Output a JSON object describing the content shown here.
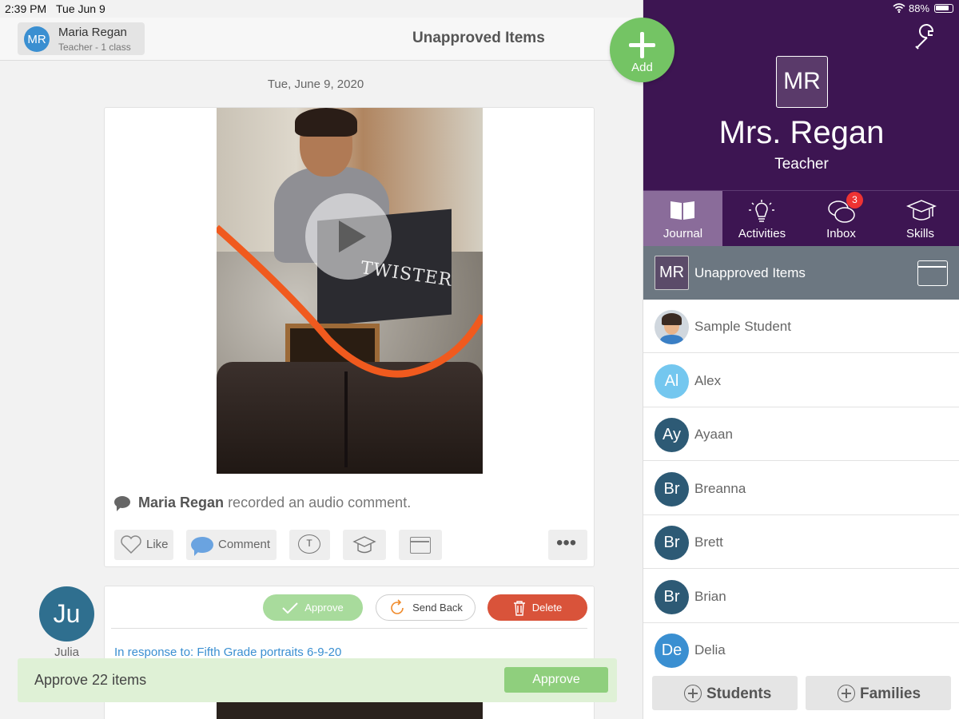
{
  "status_bar": {
    "time": "2:39 PM",
    "date": "Tue Jun 9",
    "battery": "88%"
  },
  "header": {
    "user_name": "Maria Regan",
    "user_role": "Teacher - 1 class",
    "user_initials": "MR",
    "title": "Unapproved Items"
  },
  "add_button": {
    "label": "Add"
  },
  "feed": {
    "date": "Tue, June 9, 2020",
    "post1": {
      "video_label": "TWISTER",
      "commenter": "Maria Regan",
      "comment_text": "recorded an audio comment.",
      "actions": {
        "like": "Like",
        "comment": "Comment",
        "text_icon": "T",
        "more": "•••"
      }
    },
    "post2": {
      "author_initials": "Ju",
      "author_name": "Julia",
      "approve": "Approve",
      "send_back": "Send Back",
      "delete": "Delete",
      "response": "In response to: Fifth Grade portraits 6-9-20"
    }
  },
  "approve_bar": {
    "text": "Approve 22 items",
    "button": "Approve"
  },
  "profile": {
    "initials": "MR",
    "name": "Mrs. Regan",
    "role": "Teacher"
  },
  "tabs": [
    {
      "label": "Journal",
      "icon": "book-icon",
      "active": true
    },
    {
      "label": "Activities",
      "icon": "lightbulb-icon"
    },
    {
      "label": "Inbox",
      "icon": "chat-bubbles-icon",
      "badge": "3"
    },
    {
      "label": "Skills",
      "icon": "graduation-cap-icon"
    }
  ],
  "unapproved": {
    "initials": "MR",
    "label": "Unapproved Items"
  },
  "students": [
    {
      "name": "Sample Student",
      "initials": "",
      "color": "#d0d7de"
    },
    {
      "name": "Alex",
      "initials": "Al",
      "color": "#74c7ef"
    },
    {
      "name": "Ayaan",
      "initials": "Ay",
      "color": "#2d5a75"
    },
    {
      "name": "Breanna",
      "initials": "Br",
      "color": "#2d5a75"
    },
    {
      "name": "Brett",
      "initials": "Br",
      "color": "#2d5a75"
    },
    {
      "name": "Brian",
      "initials": "Br",
      "color": "#2d5a75"
    },
    {
      "name": "Delia",
      "initials": "De",
      "color": "#3a8fd1"
    }
  ],
  "bottom_buttons": {
    "students": "Students",
    "families": "Families"
  },
  "colors": {
    "accent_purple": "#3d1552",
    "add_green": "#74c464",
    "delete_red": "#d9533a",
    "link_blue": "#3a8fd1"
  }
}
